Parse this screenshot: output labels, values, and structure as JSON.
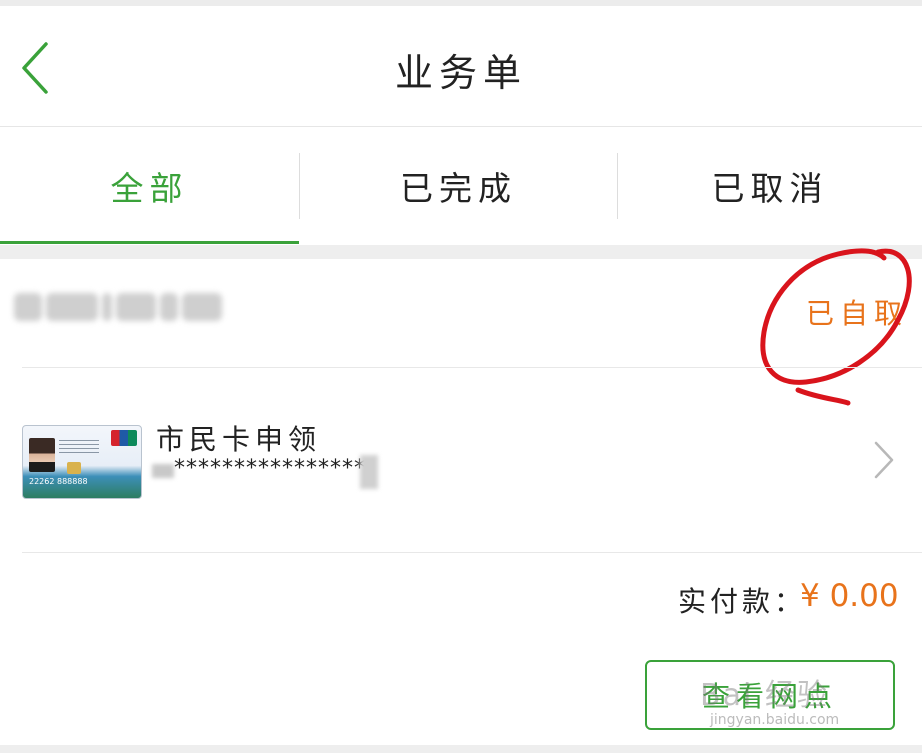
{
  "header": {
    "title": "业务单"
  },
  "tabs": [
    {
      "label": "全部",
      "active": true
    },
    {
      "label": "已完成",
      "active": false
    },
    {
      "label": "已取消",
      "active": false
    }
  ],
  "order": {
    "status": "已自取",
    "item": {
      "title": "市民卡申领",
      "id_masked": "****************",
      "card_number_fragment": "22262 888888"
    },
    "payment": {
      "label": "实付款：",
      "amount": "¥ 0.00"
    },
    "action_button": "查看网点"
  },
  "watermark": {
    "text": "Bai 经验",
    "subtext": "jingyan.baidu.com"
  },
  "colors": {
    "accent_green": "#3aa23a",
    "status_orange": "#e8731b",
    "annotation_red": "#d9141c"
  }
}
